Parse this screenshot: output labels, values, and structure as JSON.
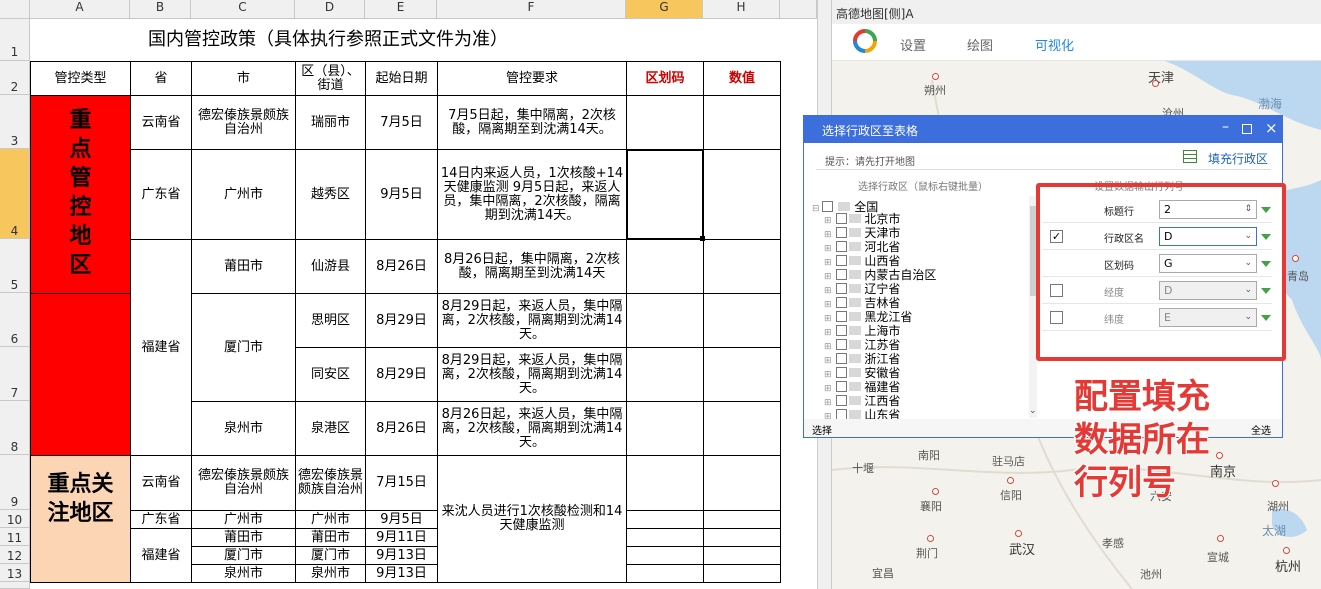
{
  "sheet": {
    "col_headers": [
      "A",
      "B",
      "C",
      "D",
      "E",
      "F",
      "G",
      "H"
    ],
    "row_headers": [
      "1",
      "2",
      "3",
      "4",
      "5",
      "6",
      "7",
      "8",
      "9",
      "10",
      "11",
      "12",
      "13"
    ],
    "title": "国内管控政策（具体执行参照正式文件为准）",
    "headers": {
      "type": "管控类型",
      "province": "省",
      "city": "市",
      "district": "区（县）、街道",
      "start": "起始日期",
      "req": "管控要求",
      "code": "区划码",
      "value": "数值"
    },
    "key_area_label": "重点管控地区",
    "focus_area_label": "重点关注地区",
    "rows": [
      {
        "province": "云南省",
        "city": "德宏傣族景颇族自治州",
        "district": "瑞丽市",
        "date": "7月5日",
        "req": "7月5日起，集中隔离，2次核酸，隔离期至到沈满14天。"
      },
      {
        "province": "广东省",
        "city": "广州市",
        "district": "越秀区",
        "date": "9月5日",
        "req": "14日内来返人员，1次核酸+14天健康监测 9月5日起，来返人员，集中隔离，2次核酸，隔离期到沈满14天。"
      },
      {
        "province": "福建省",
        "city": "莆田市",
        "district": "仙游县",
        "date": "8月26日",
        "req": "8月26日起，集中隔离，2次核酸，隔离期至到沈满14天"
      },
      {
        "city": "厦门市",
        "district": "思明区",
        "date": "8月29日",
        "req": "8月29日起，来返人员，集中隔离，2次核酸，隔离期到沈满14天。"
      },
      {
        "district": "同安区",
        "date": "8月29日",
        "req": "8月29日起，来返人员，集中隔离，2次核酸，隔离期到沈满14天。"
      },
      {
        "city": "泉州市",
        "district": "泉港区",
        "date": "8月26日",
        "req": "8月26日起，来返人员，集中隔离，2次核酸，隔离期到沈满14天。"
      }
    ],
    "focus_rows": [
      {
        "province": "云南省",
        "city": "德宏傣族景颇族自治州",
        "district": "德宏傣族景颇族自治州",
        "date": "7月15日"
      },
      {
        "province": "广东省",
        "city": "广州市",
        "district": "广州市",
        "date": "9月5日"
      },
      {
        "province": "福建省",
        "city": "莆田市",
        "district": "莆田市",
        "date": "9月11日"
      },
      {
        "city": "厦门市",
        "district": "厦门市",
        "date": "9月13日"
      },
      {
        "city": "泉州市",
        "district": "泉州市",
        "date": "9月13日"
      }
    ],
    "focus_req": "来沈人员进行1次核酸检测和14天健康监测"
  },
  "map": {
    "window_title": "高德地图[侧]A",
    "tabs": [
      "设置",
      "绘图",
      "可视化"
    ],
    "labels": [
      "天津",
      "朔州",
      "渤海",
      "沧州",
      "青岛",
      "十堰",
      "南阳",
      "驻马店",
      "信阳",
      "六安",
      "南京",
      "湖州",
      "太湖",
      "襄阳",
      "武汉",
      "宣城",
      "荆门",
      "孝感",
      "池州",
      "宜昌",
      "杭州"
    ]
  },
  "dialog": {
    "title": "选择行政区至表格",
    "hint": "提示：请先打开地图",
    "fill_button": "填充行政区",
    "tree_header": "选择行政区（鼠标右键批量）",
    "settings_header": "设置数据输出行列号",
    "root": "全国",
    "provinces": [
      "北京市",
      "天津市",
      "河北省",
      "山西省",
      "内蒙古自治区",
      "辽宁省",
      "吉林省",
      "黑龙江省",
      "上海市",
      "江苏省",
      "浙江省",
      "安徽省",
      "福建省",
      "江西省",
      "山东省"
    ],
    "select_label": "选择",
    "select_all": "全选",
    "fields": [
      {
        "label": "标题行",
        "value": "2",
        "checked": null
      },
      {
        "label": "行政区名",
        "value": "D",
        "checked": true
      },
      {
        "label": "区划码",
        "value": "G",
        "checked": null
      },
      {
        "label": "经度",
        "value": "D",
        "checked": false
      },
      {
        "label": "纬度",
        "value": "E",
        "checked": false
      }
    ]
  },
  "annotation": {
    "text": "配置填充数据所在行列号",
    "color": "#e53935"
  }
}
